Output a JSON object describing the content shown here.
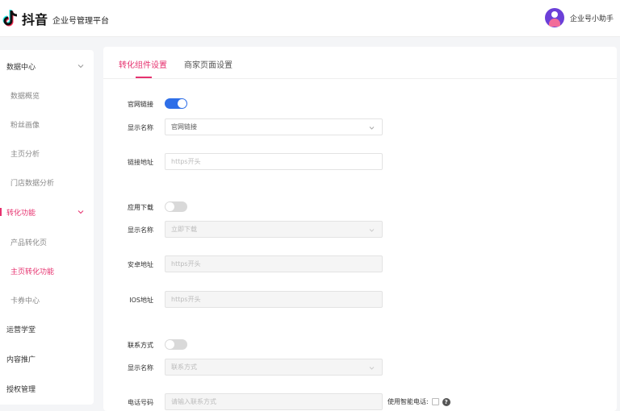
{
  "header": {
    "brand": "抖音",
    "subtitle": "企业号管理平台",
    "user_name": "企业号小助手"
  },
  "sidebar": {
    "items": [
      {
        "label": "数据中心",
        "type": "group",
        "expanded": true
      },
      {
        "label": "数据概览",
        "type": "sub"
      },
      {
        "label": "粉丝画像",
        "type": "sub"
      },
      {
        "label": "主页分析",
        "type": "sub"
      },
      {
        "label": "门店数据分析",
        "type": "sub"
      },
      {
        "label": "转化功能",
        "type": "group",
        "expanded": true,
        "active": true
      },
      {
        "label": "产品转化页",
        "type": "sub"
      },
      {
        "label": "主页转化功能",
        "type": "sub",
        "active": true
      },
      {
        "label": "卡券中心",
        "type": "sub"
      },
      {
        "label": "运营学堂",
        "type": "group"
      },
      {
        "label": "内容推广",
        "type": "group"
      },
      {
        "label": "授权管理",
        "type": "group"
      }
    ]
  },
  "tabs": [
    {
      "label": "转化组件设置",
      "active": true
    },
    {
      "label": "商家页面设置",
      "active": false
    }
  ],
  "form": {
    "website": {
      "section_label": "官网链接",
      "enabled": true,
      "display_name_label": "显示名称",
      "display_name_value": "官网链接",
      "link_label": "链接地址",
      "link_placeholder": "https开头"
    },
    "app": {
      "section_label": "应用下载",
      "enabled": false,
      "display_name_label": "显示名称",
      "display_name_value": "立即下载",
      "android_label": "安卓地址",
      "android_placeholder": "https开头",
      "ios_label": "IOS地址",
      "ios_placeholder": "https开头"
    },
    "contact": {
      "section_label": "联系方式",
      "enabled": false,
      "display_name_label": "显示名称",
      "display_name_value": "联系方式",
      "phone_label": "电话号码",
      "phone_placeholder": "请输入联系方式",
      "smart_phone_label": "使用智能电话:",
      "smart_phone_checked": false
    }
  },
  "colors": {
    "accent": "#e6326f",
    "toggle_on": "#2f6fe8",
    "toggle_off": "#d9d9d9"
  }
}
